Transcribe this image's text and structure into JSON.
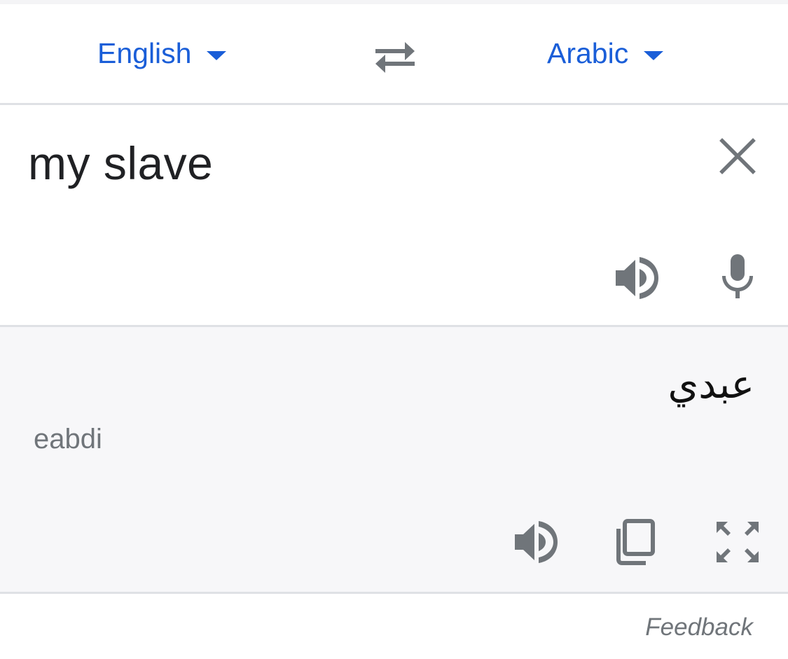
{
  "languages": {
    "source": "English",
    "target": "Arabic"
  },
  "input": {
    "text": "my slave"
  },
  "output": {
    "translation": "عبدي",
    "transliteration": "eabdi"
  },
  "footer": {
    "feedback_label": "Feedback"
  },
  "icons": {
    "swap": "swap-languages-icon",
    "clear": "close-icon",
    "source_speak": "speaker-icon",
    "mic": "microphone-icon",
    "target_speak": "speaker-icon",
    "copy": "copy-icon",
    "fullscreen": "fullscreen-icon"
  },
  "colors": {
    "accent": "#1a5ed8",
    "icon": "#70757a",
    "output_bg": "#f7f7f9"
  }
}
